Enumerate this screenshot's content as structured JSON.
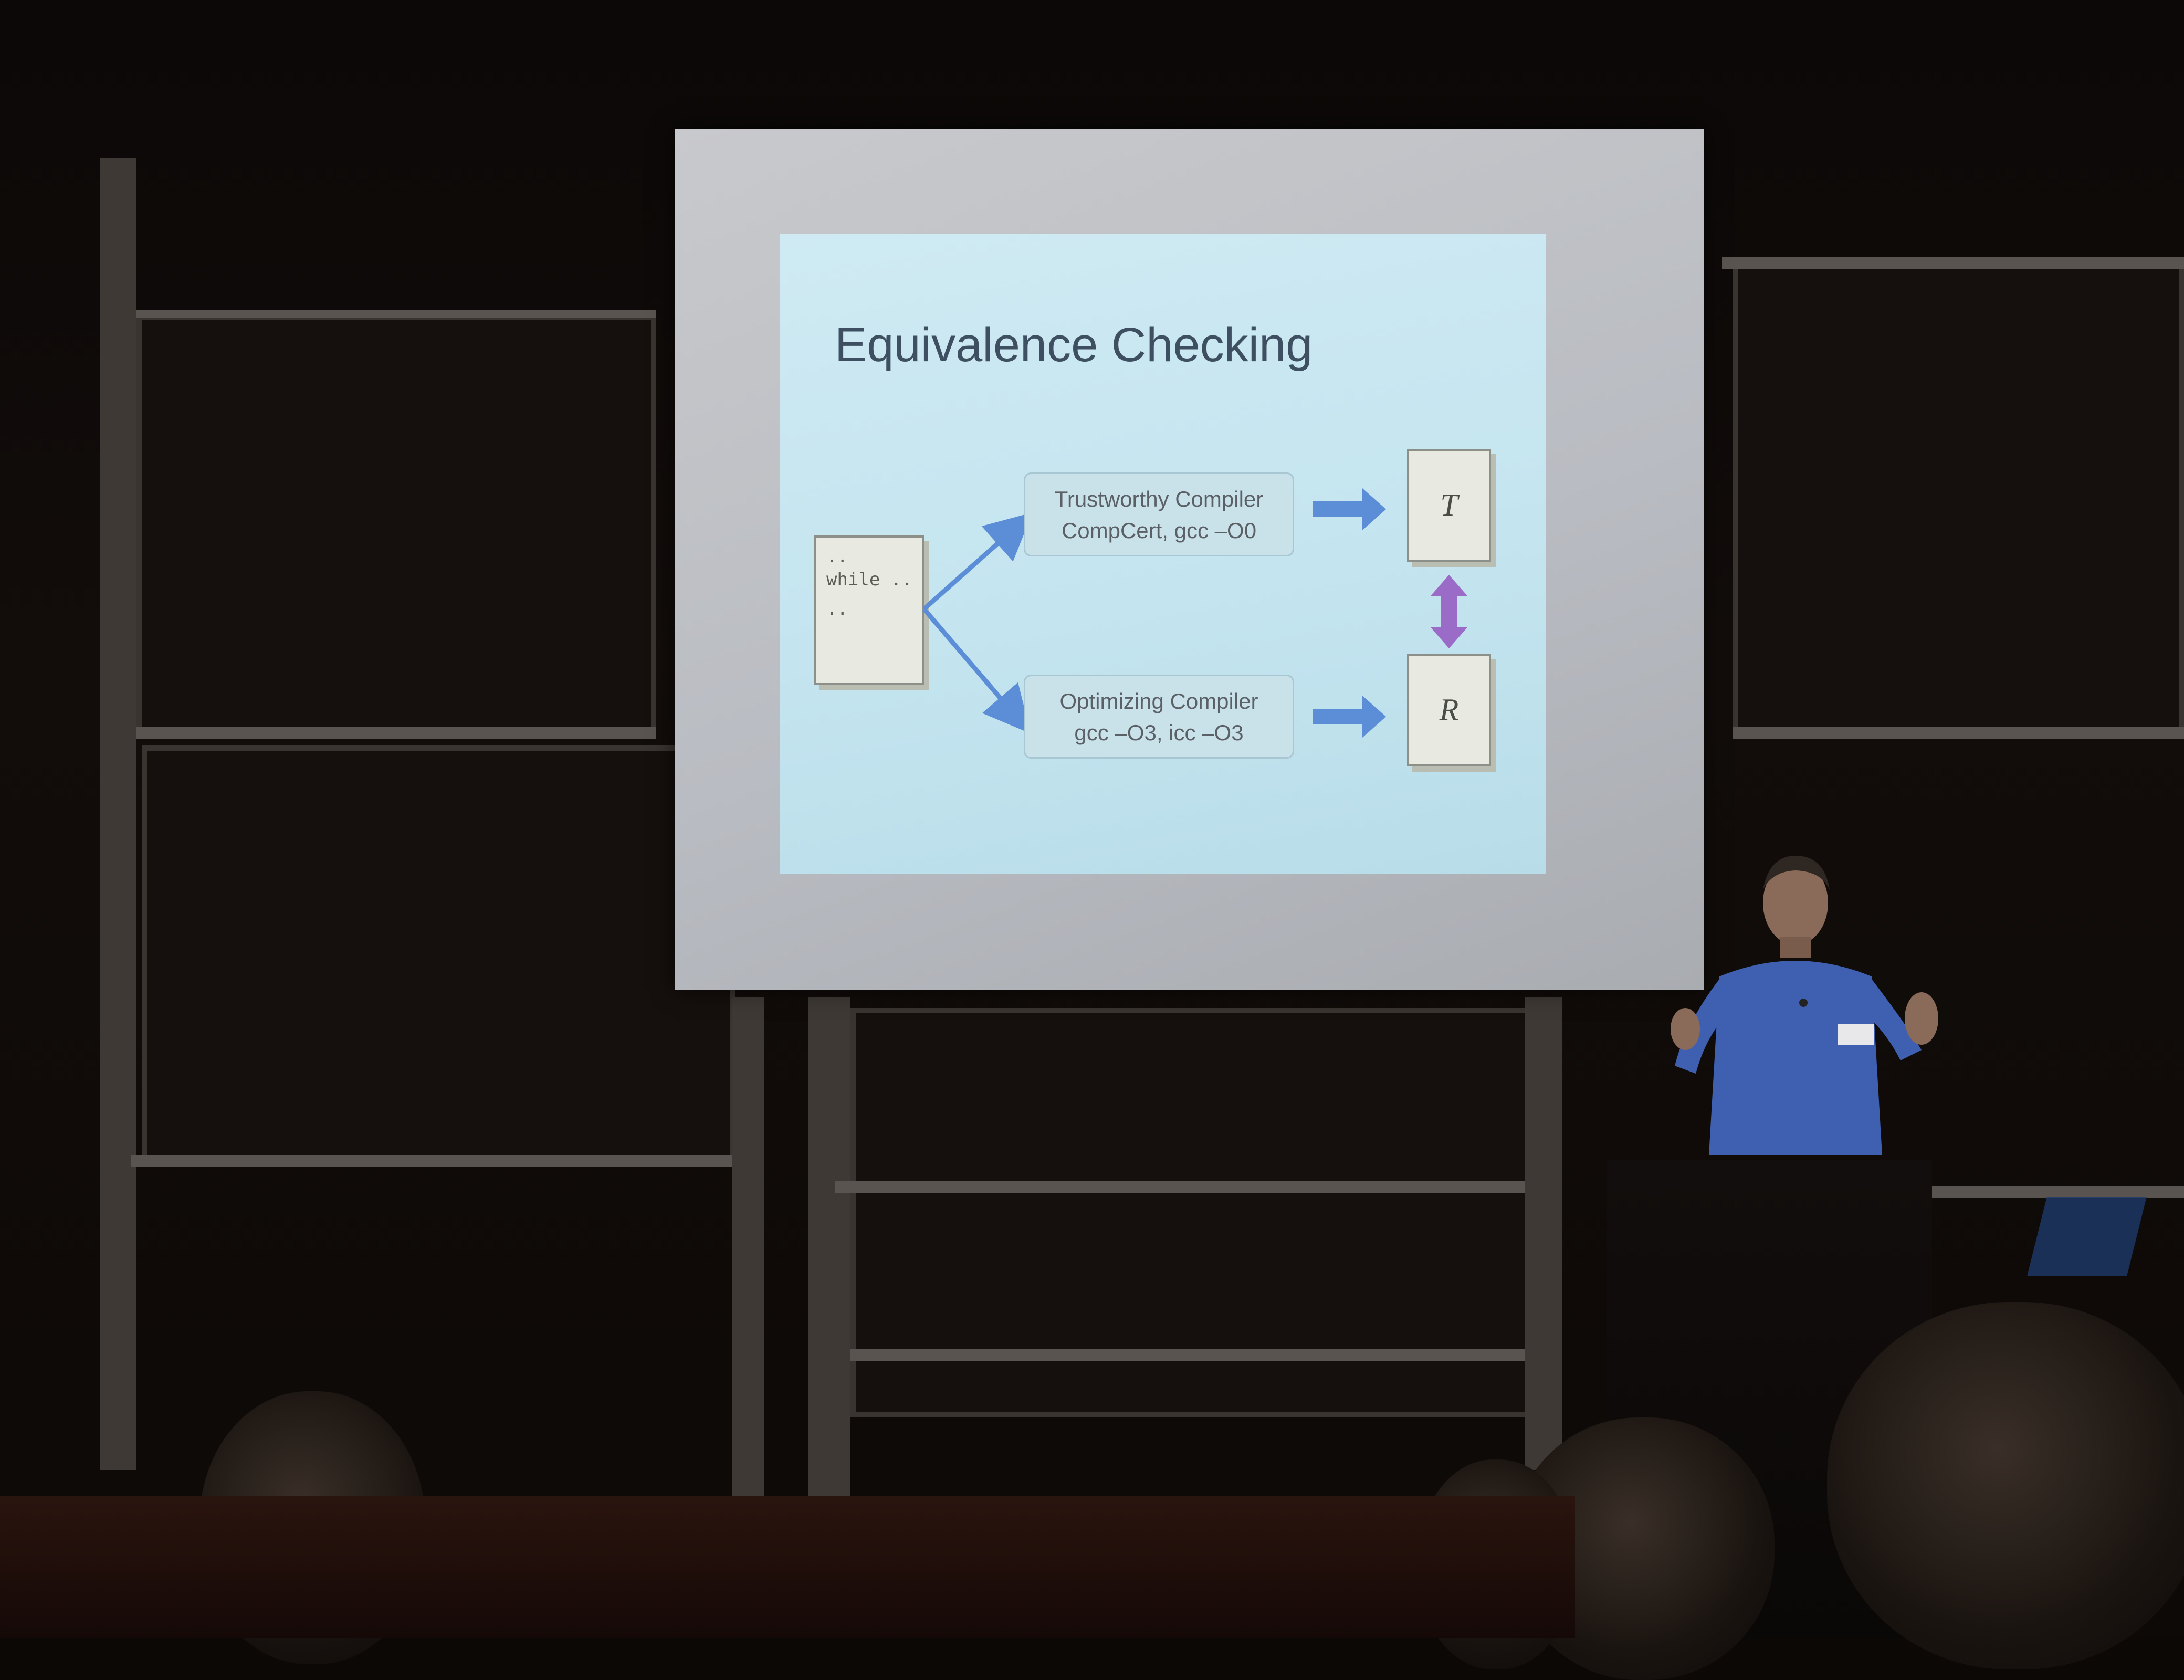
{
  "slide": {
    "title": "Equivalence Checking",
    "source_code": [
      "..",
      "while ..",
      ".."
    ],
    "trustworthy_compiler": {
      "line1": "Trustworthy Compiler",
      "line2": "CompCert, gcc –O0"
    },
    "optimizing_compiler": {
      "line1": "Optimizing Compiler",
      "line2": "gcc –O3, icc –O3"
    },
    "output_trustworthy": "T",
    "output_optimizing": "R",
    "arrow_color": "#5b8ed6",
    "equivalence_arrow_color": "#9b6bc8"
  }
}
